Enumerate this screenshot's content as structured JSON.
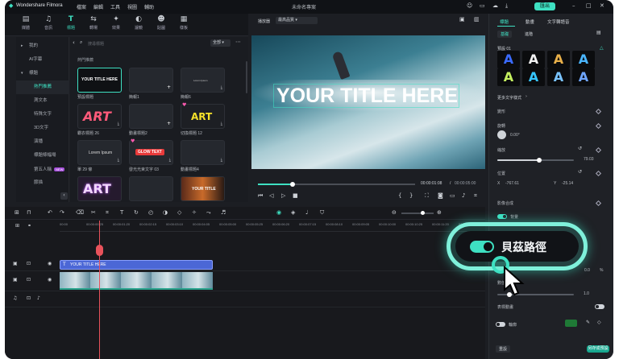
{
  "app": {
    "name": "Wondershare Filmora",
    "project": "未命名專案",
    "menus": [
      "檔案",
      "編輯",
      "工具",
      "視圖",
      "輔助"
    ],
    "export": "匯出"
  },
  "toolbar": {
    "items": [
      "媒體",
      "音訊",
      "標題",
      "轉場",
      "效果",
      "濾鏡",
      "貼圖",
      "樣板"
    ],
    "active_index": 2
  },
  "sidebar": {
    "items": [
      "我的",
      "AI字幕",
      "標題",
      "熱門推薦",
      "測文本",
      "特殊文字",
      "3D文字",
      "演播",
      "標題條幅場",
      "第五人稱",
      "節描"
    ],
    "active_index": 3,
    "new_badge": "NEW"
  },
  "search": {
    "placeholder": "搜尋標題",
    "filter": "全部"
  },
  "assets": {
    "section": "熱門推薦",
    "items": [
      {
        "label": "預設標題",
        "preview": "YOUR TITLE HERE"
      },
      {
        "label": "簡報1",
        "preview": ""
      },
      {
        "label": "簡報6",
        "preview": "Lorem Ipsum"
      },
      {
        "label": "霸衣標題 26",
        "preview": "ART"
      },
      {
        "label": "動畫標題2",
        "preview": ""
      },
      {
        "label": "切換標題 12",
        "preview": "ART"
      },
      {
        "label": "單 29 條",
        "preview": "Lorem Ipsum"
      },
      {
        "label": "發光光束文字 03",
        "preview": "GLOW TEXT"
      },
      {
        "label": "動畫標題4",
        "preview": ""
      },
      {
        "label": "",
        "preview": "ART"
      },
      {
        "label": "",
        "preview": ""
      },
      {
        "label": "",
        "preview": "YOUR TITLE"
      }
    ]
  },
  "player": {
    "label": "播放器",
    "quality": "最高品質",
    "overlay_title": "YOUR TITLE HERE",
    "current_time": "00:00:01:08",
    "total_time": "00:00:05:00",
    "progress": 0.22
  },
  "timeline": {
    "ruler": [
      "00:00",
      "00:00:00:25",
      "00:00:01:20",
      "00:00:02:15",
      "00:00:03:10",
      "00:00:04:05",
      "00:00:05:00",
      "00:00:05:25",
      "00:00:06:20",
      "00:00:07:15",
      "00:00:08:10",
      "00:00:09:05",
      "00:00:10:00",
      "00:00:10:25",
      "00:00:11:20",
      "00:00:12:15"
    ],
    "title_clip": "YOUR TITLE HERE",
    "playhead_progress": 0.085
  },
  "panel": {
    "tabs": [
      "標題",
      "動畫",
      "文字轉語音"
    ],
    "subtabs": [
      "基礎",
      "進階"
    ],
    "preset_label": "預設 01",
    "more_styles": "更多文字樣式",
    "transform": "變形",
    "rotate": "旋轉",
    "rotate_value": "0.00°",
    "scale": "縮放",
    "scale_value": "79.03",
    "scale_progress": 0.55,
    "position": "位置",
    "pos_x_label": "X",
    "pos_x": "-767.61",
    "pos_y_label": "Y",
    "pos_y": "-25.14",
    "compositing": "影像合成",
    "background": "背景",
    "highlight": "貝茲路徑",
    "opacity_value": "0.0",
    "opacity_unit": "%",
    "speed_label": "數值",
    "speed_value": "1.0",
    "bezier_label": "表標動畫",
    "border": "輪廓",
    "border_color": "#1f7a36",
    "reset": "重設",
    "save": "另存成預設"
  }
}
